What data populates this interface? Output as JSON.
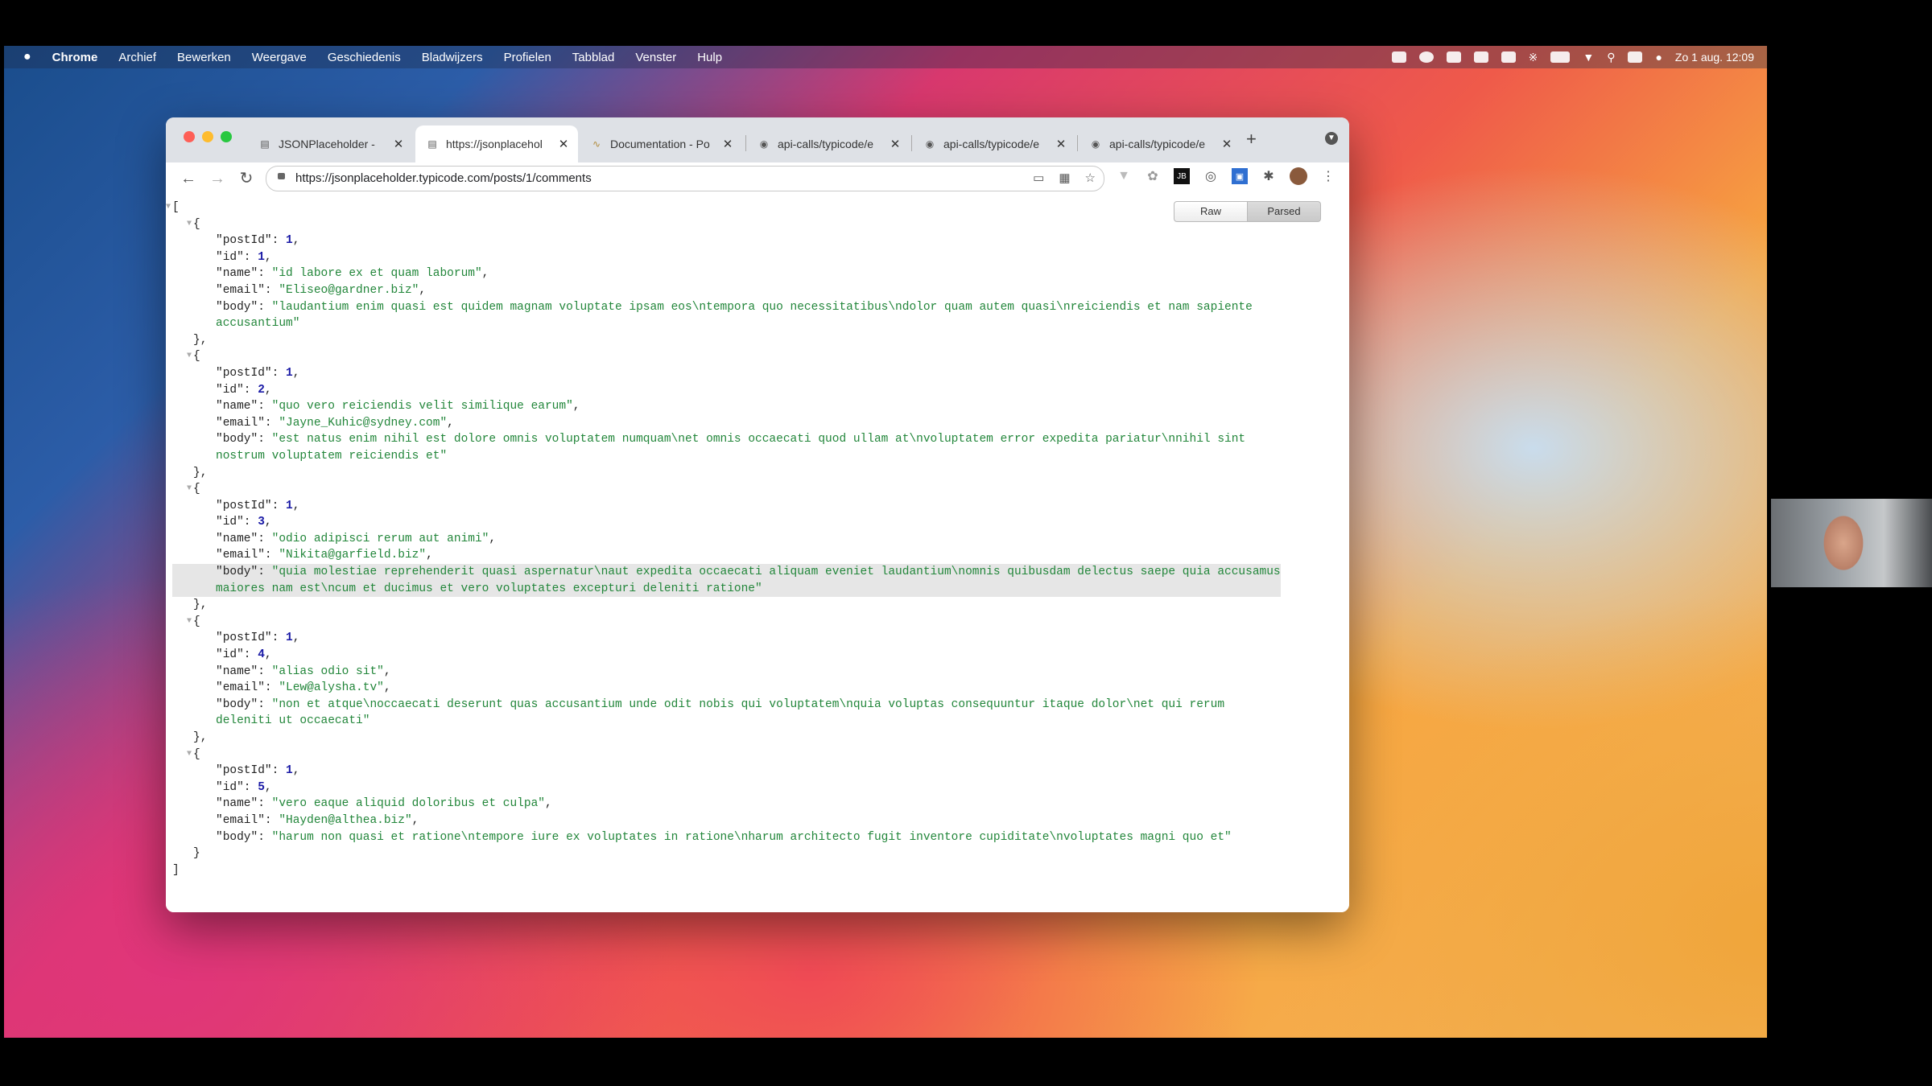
{
  "menubar": {
    "apple": "",
    "items": [
      "Chrome",
      "Archief",
      "Bewerken",
      "Weergave",
      "Geschiedenis",
      "Bladwijzers",
      "Profielen",
      "Tabblad",
      "Venster",
      "Hulp"
    ],
    "clock": "Zo 1 aug.  12:09"
  },
  "browser": {
    "tabs": [
      {
        "title": "JSONPlaceholder -",
        "active": false
      },
      {
        "title": "https://jsonplacehol",
        "active": true
      },
      {
        "title": "Documentation - Po",
        "active": false
      },
      {
        "title": "api-calls/typicode/e",
        "active": false
      },
      {
        "title": "api-calls/typicode/e",
        "active": false
      },
      {
        "title": "api-calls/typicode/e",
        "active": false
      }
    ],
    "new_tab": "+",
    "url": "https://jsonplaceholder.typicode.com/posts/1/comments"
  },
  "viewer": {
    "raw_label": "Raw",
    "parsed_label": "Parsed",
    "comments": [
      {
        "postId": "1",
        "id": "1",
        "name": "\"id labore ex et quam laborum\"",
        "email": "\"Eliseo@gardner.biz\"",
        "body1": "\"laudantium enim quasi est quidem magnam voluptate ipsam eos\\ntempora quo necessitatibus\\ndolor quam autem quasi\\nreiciendis et nam sapiente",
        "body2": "accusantium\""
      },
      {
        "postId": "1",
        "id": "2",
        "name": "\"quo vero reiciendis velit similique earum\"",
        "email": "\"Jayne_Kuhic@sydney.com\"",
        "body1": "\"est natus enim nihil est dolore omnis voluptatem numquam\\net omnis occaecati quod ullam at\\nvoluptatem error expedita pariatur\\nnihil sint",
        "body2": "nostrum voluptatem reiciendis et\""
      },
      {
        "postId": "1",
        "id": "3",
        "name": "\"odio adipisci rerum aut animi\"",
        "email": "\"Nikita@garfield.biz\"",
        "body1": "\"quia molestiae reprehenderit quasi aspernatur\\naut expedita occaecati aliquam eveniet laudantium\\nomnis quibusdam delectus saepe quia accusamus",
        "body2": "maiores nam est\\ncum et ducimus et vero voluptates excepturi deleniti ratione\""
      },
      {
        "postId": "1",
        "id": "4",
        "name": "\"alias odio sit\"",
        "email": "\"Lew@alysha.tv\"",
        "body1": "\"non et atque\\noccaecati deserunt quas accusantium unde odit nobis qui voluptatem\\nquia voluptas consequuntur itaque dolor\\net qui rerum",
        "body2": "deleniti ut occaecati\""
      },
      {
        "postId": "1",
        "id": "5",
        "name": "\"vero eaque aliquid doloribus et culpa\"",
        "email": "\"Hayden@althea.biz\"",
        "body1": "\"harum non quasi et ratione\\ntempore iure ex voluptates in ratione\\nharum architecto fugit inventore cupiditate\\nvoluptates magni quo et\"",
        "body2": ""
      }
    ]
  }
}
